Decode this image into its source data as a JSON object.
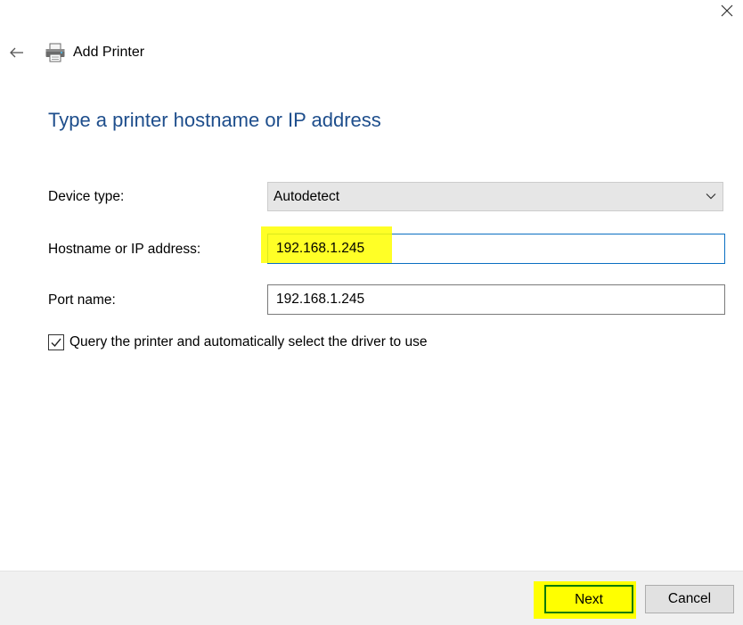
{
  "window": {
    "title": "Add Printer",
    "close_icon": "close-icon",
    "back_icon": "back-arrow-icon",
    "printer_icon": "printer-icon"
  },
  "page": {
    "heading": "Type a printer hostname or IP address"
  },
  "form": {
    "device_type": {
      "label": "Device type:",
      "value": "Autodetect"
    },
    "hostname": {
      "label": "Hostname or IP address:",
      "value": "192.168.1.245"
    },
    "port_name": {
      "label": "Port name:",
      "value": "192.168.1.245"
    },
    "query_checkbox": {
      "label": "Query the printer and automatically select the driver to use",
      "checked": true
    }
  },
  "footer": {
    "next_label": "Next",
    "cancel_label": "Cancel"
  },
  "colors": {
    "heading": "#1e4e8c",
    "highlight": "#ffff00",
    "focus_border": "#0a6fc2",
    "next_border": "#0a7a0a"
  }
}
